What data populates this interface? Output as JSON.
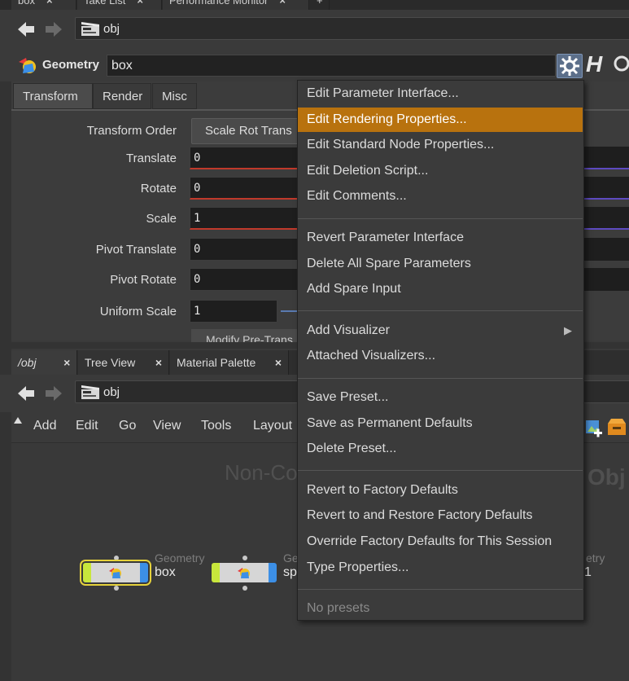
{
  "top_tabs": [
    {
      "label": "box",
      "close": "×"
    },
    {
      "label": "Take List",
      "close": "×"
    },
    {
      "label": "Performance Monitor",
      "close": "×"
    },
    {
      "label": "+"
    }
  ],
  "top_nav": {
    "path": "obj"
  },
  "header": {
    "context_label": "Geometry",
    "node_name": "box",
    "help": "H"
  },
  "param_tabs": [
    "Transform",
    "Render",
    "Misc"
  ],
  "params": {
    "transform_order_label": "Transform Order",
    "transform_order_value": "Scale Rot Trans",
    "translate_label": "Translate",
    "translate_value": "0",
    "rotate_label": "Rotate",
    "rotate_value": "0",
    "scale_label": "Scale",
    "scale_value": "1",
    "pivot_translate_label": "Pivot Translate",
    "pivot_translate_value": "0",
    "pivot_rotate_label": "Pivot Rotate",
    "pivot_rotate_value": "0",
    "uniform_scale_label": "Uniform Scale",
    "uniform_scale_value": "1",
    "modify_button": "Modify Pre-Trans"
  },
  "lower_tabs": [
    {
      "label": "/obj",
      "close": "×"
    },
    {
      "label": "Tree View",
      "close": "×"
    },
    {
      "label": "Material Palette",
      "close": "×"
    }
  ],
  "lower_nav": {
    "path": "obj"
  },
  "network_menu": [
    "Add",
    "Edit",
    "Go",
    "View",
    "Tools",
    "Layout"
  ],
  "network": {
    "watermark": "Non-Co",
    "watermark_right": "Obj",
    "nodes": [
      {
        "type": "Geometry",
        "name": "box"
      },
      {
        "type": "Ge",
        "name": "sp"
      },
      {
        "type": "etry",
        "name": "1"
      }
    ]
  },
  "context_menu": {
    "groups": [
      [
        "Edit Parameter Interface...",
        "Edit Rendering Properties...",
        "Edit Standard Node Properties...",
        "Edit Deletion Script...",
        "Edit Comments..."
      ],
      [
        "Revert Parameter Interface",
        "Delete All Spare Parameters",
        "Add Spare Input"
      ],
      [
        "Add Visualizer",
        "Attached Visualizers..."
      ],
      [
        "Save Preset...",
        "Save as Permanent Defaults",
        "Delete Preset..."
      ],
      [
        "Revert to Factory Defaults",
        "Revert to and Restore Factory Defaults",
        "Override Factory Defaults for This Session",
        "Type Properties..."
      ],
      [
        "No presets"
      ]
    ],
    "highlighted": "Edit Rendering Properties...",
    "highlight_color": "#b8720e",
    "submenu_arrow": "▶"
  }
}
